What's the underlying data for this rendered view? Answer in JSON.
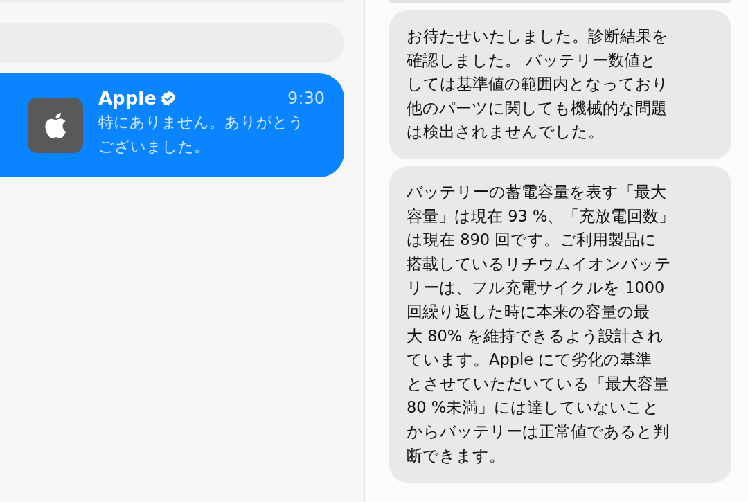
{
  "conversation_list": {
    "items": [
      {
        "name": "Apple",
        "verified": true,
        "time": "9:30",
        "preview_lines": [
          "特にありません。ありがとう",
          "ございました。"
        ],
        "selected": true
      }
    ]
  },
  "messages": [
    {
      "lines": [
        "お待たせいたしました。診断結果を",
        "確認しました。 バッテリー数値と",
        "しては基準値の範囲内となっており",
        "他のパーツに関しても機械的な問題",
        "は検出されませんでした。"
      ]
    },
    {
      "lines": [
        "バッテリーの蓄電容量を表す「最大",
        "容量」は現在 93 %、「充放電回数」",
        "は現在 890 回です。ご利用製品に",
        "搭載しているリチウムイオンバッテ",
        "リーは、フル充電サイクルを 1000",
        "回繰り返した時に本来の容量の最",
        "大 80% を維持できるよう設計され",
        "ています。Apple にて劣化の基準",
        "とさせていただいている「最大容量",
        "80 %未満」には達していないこと",
        "からバッテリーは正常値であると判",
        "断できます。"
      ]
    }
  ]
}
